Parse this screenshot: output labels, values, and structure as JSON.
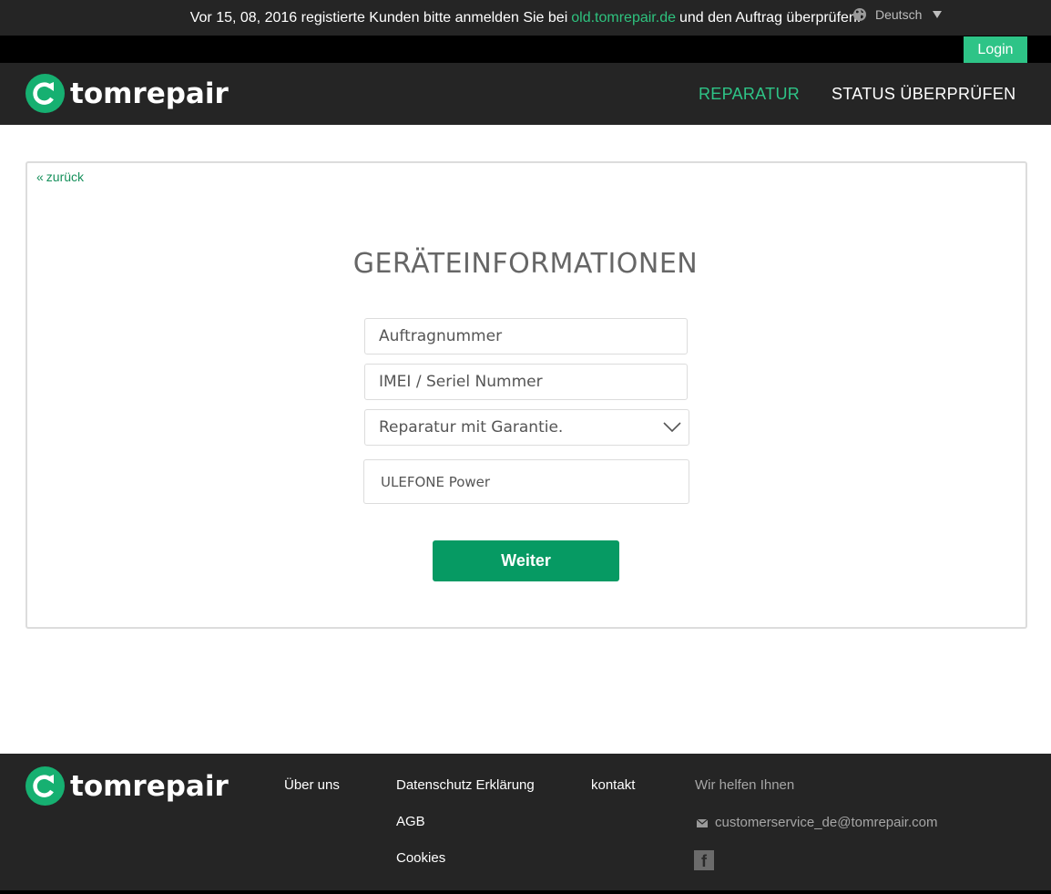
{
  "notice": {
    "text_before": "Vor 15, 08, 2016 registierte Kunden bitte anmelden Sie bei",
    "link": "old.tomrepair.de",
    "text_after": "und den Auftrag überprüfen."
  },
  "utility": {
    "language": "Deutsch",
    "login_label": "Login"
  },
  "brand": {
    "name": "tomrepair",
    "accent": "#2ec487",
    "logo_color": "#16b071"
  },
  "nav": {
    "items": [
      {
        "label": "REPARATUR",
        "active": true
      },
      {
        "label": "STATUS ÜBERPRÜFEN",
        "active": false
      }
    ]
  },
  "form": {
    "back_label": "zurück",
    "title": "GERÄTEINFORMATIONEN",
    "order_placeholder": "Auftragnummer",
    "imei_placeholder": "IMEI / Seriel Nummer",
    "repair_type_selected": "Reparatur mit Garantie.",
    "model_value": "ULEFONE Power",
    "submit_label": "Weiter"
  },
  "footer": {
    "col1": [
      "Über uns"
    ],
    "col2": [
      "Datenschutz Erklärung",
      "AGB",
      "Cookies"
    ],
    "col3": [
      "kontakt"
    ],
    "help_title": "Wir helfen Ihnen",
    "email": "customerservice_de@tomrepair.com",
    "social_icon": "facebook-icon"
  }
}
